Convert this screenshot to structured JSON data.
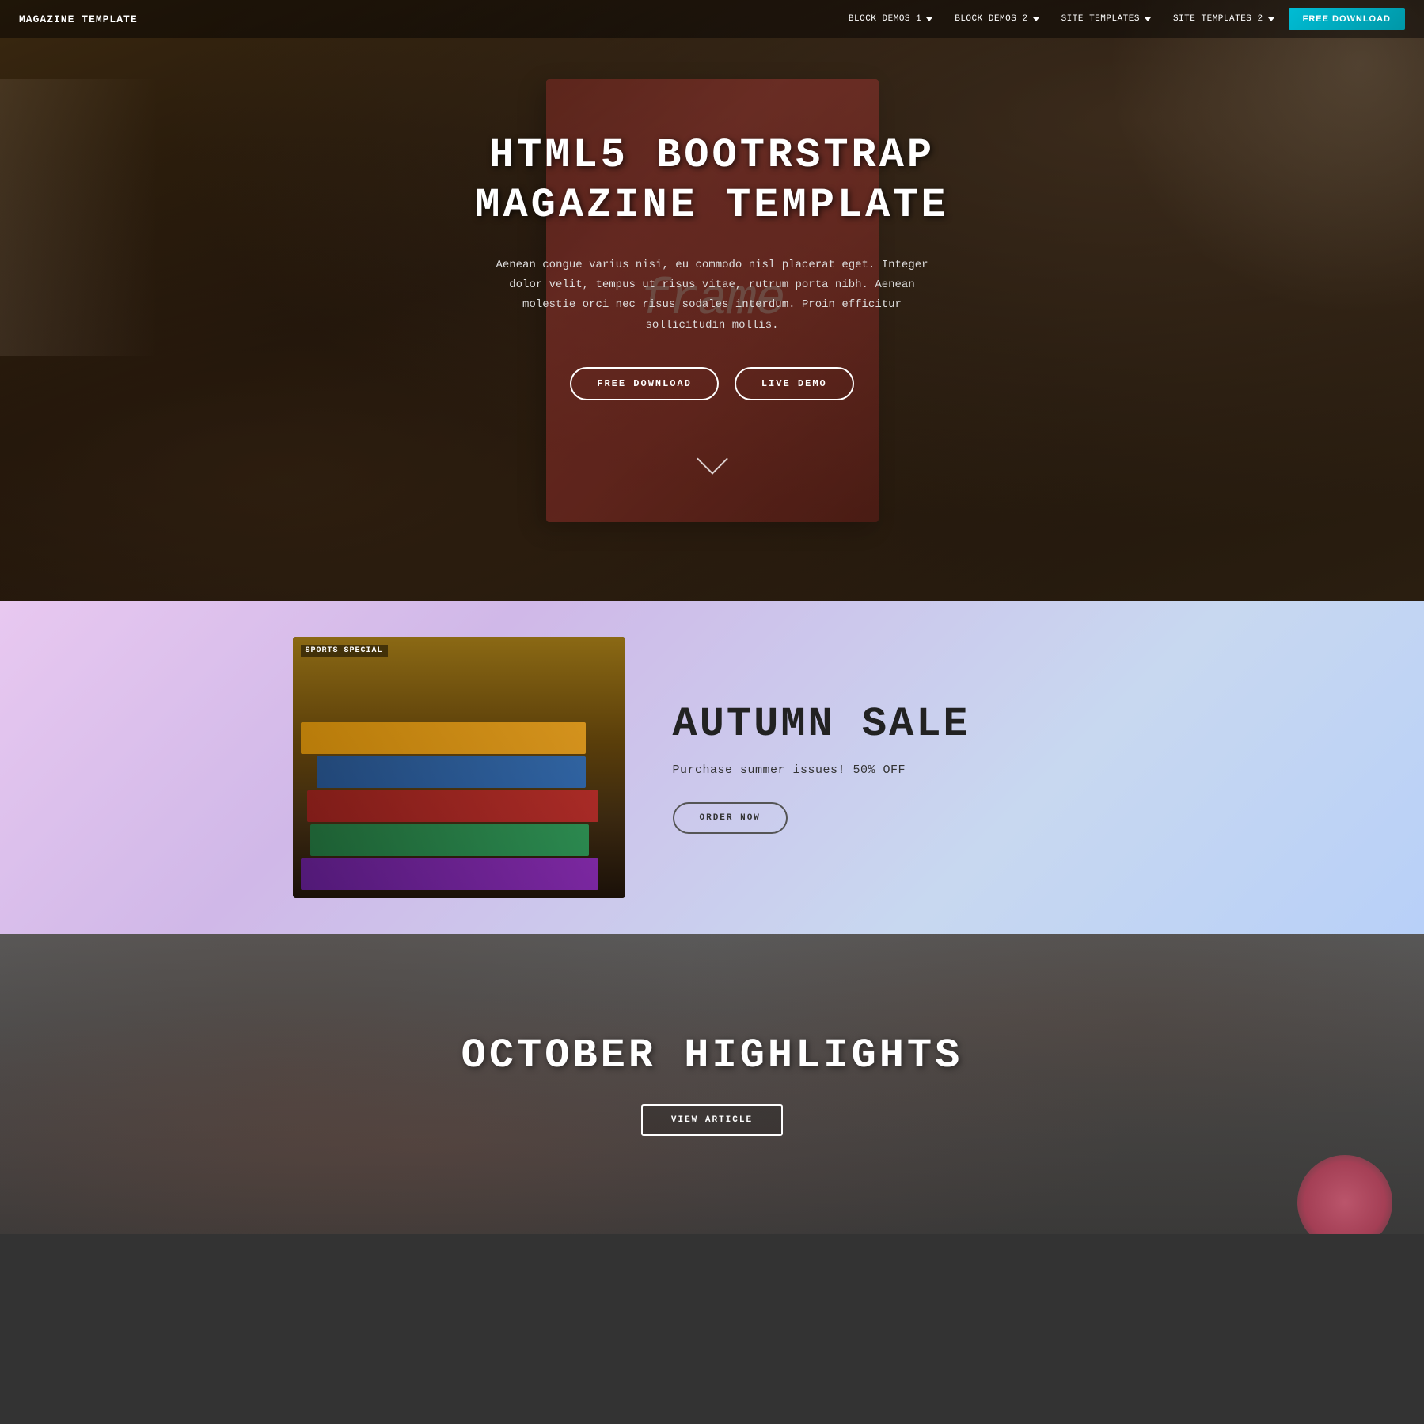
{
  "navbar": {
    "brand": "MAGAZINE TEMPLATE",
    "links": [
      {
        "label": "BLOCK DEMOS 1",
        "has_dropdown": true
      },
      {
        "label": "BLOCK DEMOS 2",
        "has_dropdown": true
      },
      {
        "label": "SITE TEMPLATES",
        "has_dropdown": true
      },
      {
        "label": "SITE TEMPLATES 2",
        "has_dropdown": true
      }
    ],
    "cta": "FREE DOWNLOAD"
  },
  "hero": {
    "title": "HTML5 BOOTRSTRAP MAGAZINE TEMPLATE",
    "description": "Aenean congue varius nisi, eu commodo nisl placerat eget. Integer dolor velit, tempus ut risus vitae, rutrum porta nibh. Aenean molestie orci nec risus sodales interdum. Proin efficitur sollicitudin mollis.",
    "btn_download": "FREE DOWNLOAD",
    "btn_demo": "LIVE DEMO",
    "scroll_label": "scroll down"
  },
  "autumn": {
    "title": "AUTUMN SALE",
    "subtitle": "Purchase summer issues! 50% OFF",
    "btn_order": "ORDER NOW",
    "magazine_label": "SPORTS SPECIAL"
  },
  "highlights": {
    "title": "OCTOBER HIGHLIGHTS",
    "btn_article": "VIEW ARTICLE"
  }
}
